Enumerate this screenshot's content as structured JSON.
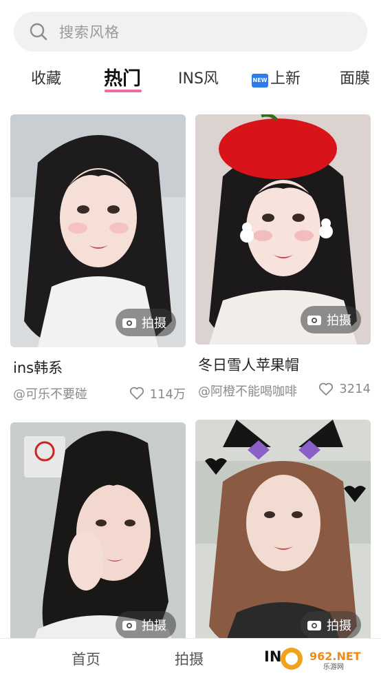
{
  "search": {
    "placeholder": "搜索风格"
  },
  "tabs": [
    {
      "label": "收藏"
    },
    {
      "label": "热门"
    },
    {
      "label": "INS风"
    },
    {
      "label": "上新",
      "badge": "NEW"
    },
    {
      "label": "面膜"
    }
  ],
  "active_tab": "热门",
  "accent_color": "#ef6aa0",
  "cards": [
    {
      "title": "ins韩系",
      "author": "@可乐不要碰",
      "likes": "114万",
      "button": "拍摄"
    },
    {
      "title": "冬日雪人苹果帽",
      "author": "@阿橙不能喝咖啡",
      "likes": "3214",
      "button": "拍摄"
    },
    {
      "title": "",
      "author": "",
      "likes": "",
      "button": "拍摄"
    },
    {
      "title": "",
      "author": "",
      "likes": "",
      "button": "拍摄"
    }
  ],
  "bottom_nav": [
    {
      "label": "首页"
    },
    {
      "label": "拍摄"
    },
    {
      "label": "INS"
    }
  ],
  "watermark": {
    "text": "962.NET",
    "subtext": "乐游网"
  }
}
